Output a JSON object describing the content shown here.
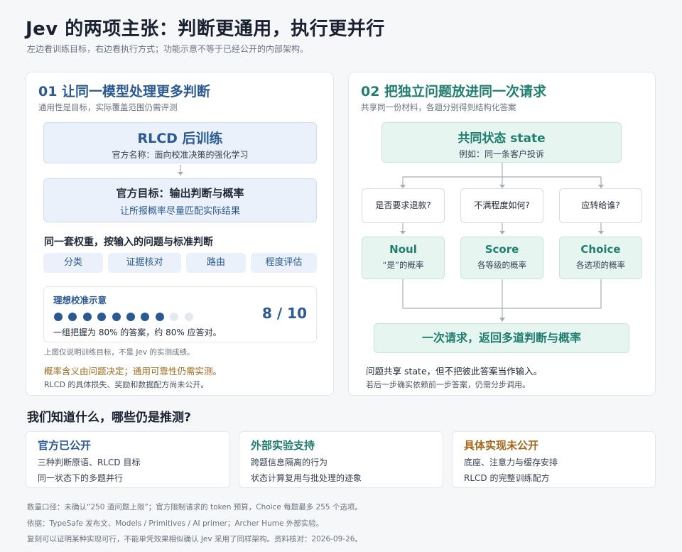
{
  "title": "Jev 的两项主张：判断更通用，执行更并行",
  "subtitle": "左边看训练目标，右边看执行方式；功能示意不等于已经公开的内部架构。",
  "left": {
    "heading": "01  让同一模型处理更多判断",
    "subheading": "通用性是目标，实际覆盖范围仍需评测",
    "box1_title": "RLCD 后训练",
    "box1_sub": "官方名称：面向校准决策的强化学习",
    "box2_title": "官方目标：输出判断与概率",
    "box2_sub": "让所报概率尽量匹配实际结果",
    "weights_label": "同一套权重，按输入的问题与标准判断",
    "tags": [
      "分类",
      "证据核对",
      "路由",
      "程度评估"
    ],
    "calib_title": "理想校准示意",
    "calib_filled": 8,
    "calib_total": 10,
    "calib_score": "8 / 10",
    "calib_desc": "一组把握为 80% 的答案，约 80% 应答对。",
    "note1": "上图仅说明训练目标，不是 Jev 的实测成绩。",
    "note2": "概率含义由问题决定；通用可靠性仍需实测。",
    "note3": "RLCD 的具体损失、奖励和数据配方尚未公开。"
  },
  "right": {
    "heading": "02  把独立问题放进同一次请求",
    "subheading": "共享同一份材料，各题分别得到结构化答案",
    "state_title": "共同状态 state",
    "state_sub": "例如：同一条客户投诉",
    "questions": [
      "是否要求退款?",
      "不满程度如何?",
      "应转给谁?"
    ],
    "outputs": [
      {
        "name": "Noul",
        "desc": "“是”的概率"
      },
      {
        "name": "Score",
        "desc": "各等级的概率"
      },
      {
        "name": "Choice",
        "desc": "各选项的概率"
      }
    ],
    "result": "一次请求，返回多道判断与概率",
    "note1": "问题共享 state，但不把彼此答案当作输入。",
    "note2": "若后一步确实依赖前一步答案，仍需分步调用。"
  },
  "section_title": "我们知道什么，哪些仍是推测?",
  "cards": [
    {
      "title": "官方已公开",
      "color": "#2b5a93",
      "lines": [
        "三种判断原语、RLCD 目标",
        "同一状态下的多题并行"
      ]
    },
    {
      "title": "外部实验支持",
      "color": "#1f7e6e",
      "lines": [
        "跨题信息隔离的行为",
        "状态计算复用与批处理的迹象"
      ]
    },
    {
      "title": "具体实现未公开",
      "color": "#a0681c",
      "lines": [
        "底座、注意力与缓存安排",
        "RLCD 的完整训练配方"
      ]
    }
  ],
  "footer": [
    "数量口径：未确认“250 道问题上限”；官方限制请求的 token 预算，Choice 每题最多 255 个选项。",
    "依据：TypeSafe 发布文、Models / Primitives / AI primer；Archer Hume 外部实验。",
    "复刻可以证明某种实现可行，不能单凭效果相似确认 Jev 采用了同样架构。资料核对：2026-09-26。"
  ],
  "colors": {
    "blue": "#2b5a93",
    "teal": "#1f7e6e",
    "amber": "#a0681c"
  }
}
